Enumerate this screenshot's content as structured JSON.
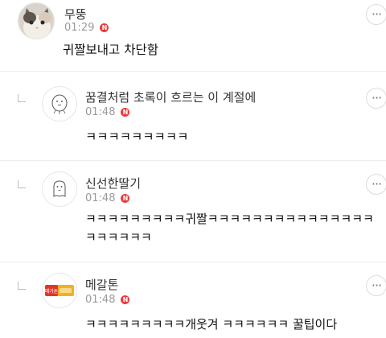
{
  "comments": [
    {
      "author": "무뚱",
      "time": "01:29",
      "badge": "N",
      "body": "귀짤보내고 차단함",
      "avatar": "cat-photo",
      "more_icon": "ellipsis-icon"
    },
    {
      "author": "꿈결처럼 초록이 흐르는 이 계절에",
      "time": "01:48",
      "badge": "N",
      "body": "ㅋㅋㅋㅋㅋㅋㅋㅋㅋ",
      "avatar": "round-face-doodle",
      "reply": true
    },
    {
      "author": "신선한딸기",
      "time": "01:48",
      "badge": "N",
      "body": "ㅋㅋㅋㅋㅋㅋㅋㅋㅋ귀짤ㅋㅋㅋㅋㅋㅋㅋㅋㅋㅋㅋㅋㅋㅋㅋㅋㅋㅋㅋㅋㅋ",
      "avatar": "ghost-doodle",
      "reply": true
    },
    {
      "author": "메갈톤",
      "time": "01:48",
      "badge": "N",
      "body": "ㅋㅋㅋㅋㅋㅋㅋㅋㅋ개웃겨 ㅋㅋㅋㅋㅋㅋ 꿀팁이다",
      "avatar": "snack-bar-package",
      "avatar_text": "메가톤",
      "reply": true
    }
  ],
  "colors": {
    "badge": "#ea3b3b",
    "meta": "#9a9a9a",
    "separator": "#ececec"
  }
}
